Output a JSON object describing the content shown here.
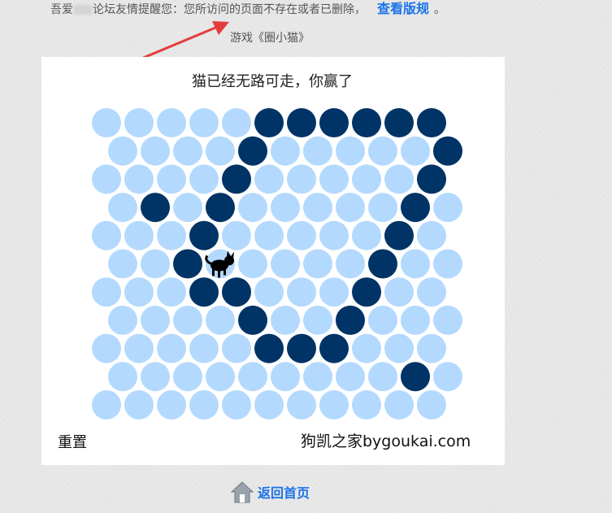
{
  "notice": {
    "prefix": "吾爱",
    "text": "论坛友情提醒您：您所访问的页面不存在或者已删除，",
    "link": "查看版规",
    "suffix": "。"
  },
  "game_label": "游戏《圈小猫》",
  "game": {
    "message": "猫已经无路可走，你赢了",
    "reset_label": "重置",
    "watermark": "狗凯之家bygoukai.com",
    "grid": {
      "rows": 11,
      "cols": 11,
      "cat": [
        5,
        3
      ],
      "blocked": [
        [
          0,
          5
        ],
        [
          0,
          6
        ],
        [
          0,
          7
        ],
        [
          0,
          8
        ],
        [
          0,
          9
        ],
        [
          0,
          10
        ],
        [
          1,
          4
        ],
        [
          1,
          10
        ],
        [
          2,
          4
        ],
        [
          2,
          10
        ],
        [
          3,
          1
        ],
        [
          3,
          3
        ],
        [
          3,
          9
        ],
        [
          4,
          3
        ],
        [
          4,
          9
        ],
        [
          5,
          2
        ],
        [
          5,
          8
        ],
        [
          6,
          3
        ],
        [
          6,
          4
        ],
        [
          6,
          8
        ],
        [
          7,
          4
        ],
        [
          7,
          7
        ],
        [
          8,
          5
        ],
        [
          8,
          6
        ],
        [
          8,
          7
        ],
        [
          9,
          9
        ]
      ],
      "colors": {
        "open": "#b3d9fe",
        "blocked": "#003366",
        "cat": "#000000"
      }
    }
  },
  "home_link": "返回首页"
}
